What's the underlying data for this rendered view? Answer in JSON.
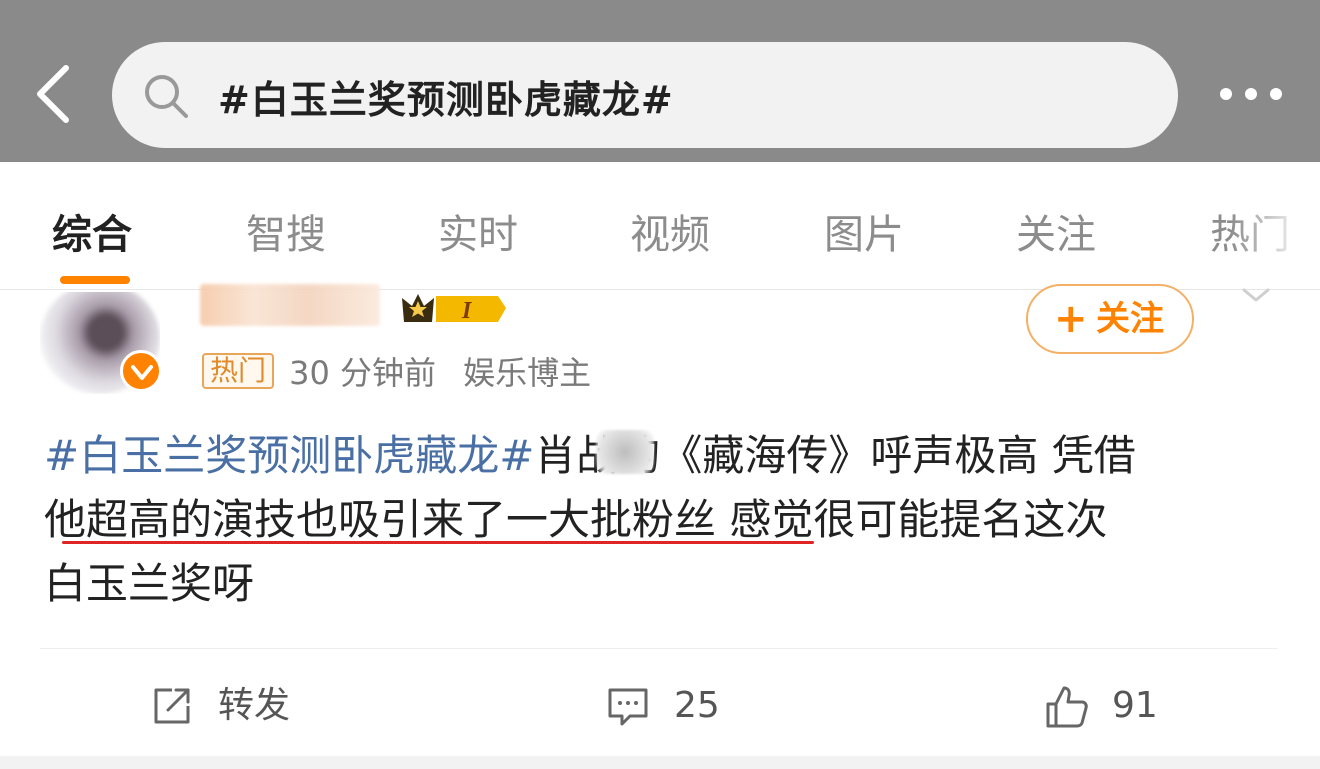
{
  "search": {
    "query": "#白玉兰奖预测卧虎藏龙#"
  },
  "tabs": [
    {
      "label": "综合",
      "active": true
    },
    {
      "label": "智搜",
      "active": false
    },
    {
      "label": "实时",
      "active": false
    },
    {
      "label": "视频",
      "active": false
    },
    {
      "label": "图片",
      "active": false
    },
    {
      "label": "关注",
      "active": false
    },
    {
      "label": "热门",
      "active": false
    }
  ],
  "post": {
    "hot_tag": "热门",
    "time": "30 分钟前",
    "role": "娱乐博主",
    "follow_label": "关注",
    "level_badge": "I",
    "text": {
      "hashtag": "#白玉兰奖预测卧虎藏龙#",
      "line1_rest": "肖战的《藏海传》呼声极高 凭借",
      "line2_prefix": "他",
      "line2_underlined": "超高的演技也吸引来了一大批粉丝",
      "line2_rest": " 感觉很可能提名这次",
      "line3": "白玉兰奖呀"
    },
    "actions": {
      "repost_label": "转发",
      "comment_count": "25",
      "like_count": "91"
    }
  },
  "colors": {
    "accent": "#ff8200",
    "hashtag": "#4a6fa5",
    "underline": "#e02424",
    "header_bg": "#8a8a8a"
  }
}
